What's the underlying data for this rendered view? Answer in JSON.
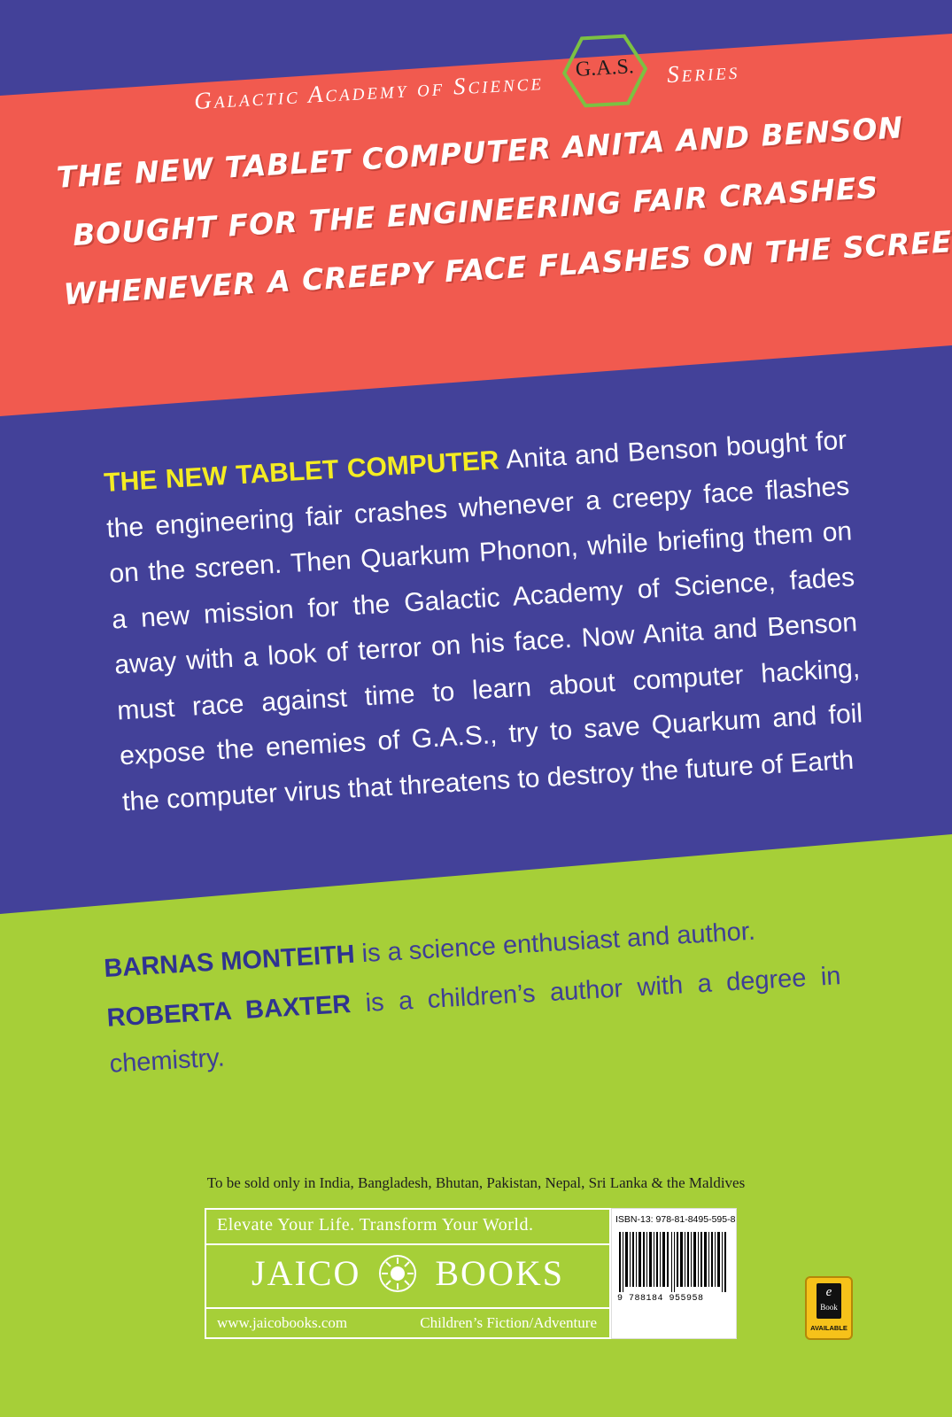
{
  "colors": {
    "indigo": "#434199",
    "salmon": "#f15a4f",
    "lime": "#a6cf38",
    "highlight_yellow": "#f4ec22",
    "author_blue": "#2f3391",
    "hexagon_green": "#7cc142"
  },
  "series": {
    "left_text": "Galactic Academy of Science",
    "badge_text": "G.A.S.",
    "right_text": "Series"
  },
  "tagline": {
    "line1": "The new tablet computer Anita and Benson",
    "line2": "bought for the engineering fair crashes",
    "line3": "whenever a creepy face flashes on the screen."
  },
  "blurb": {
    "lead": "THE NEW TABLET COMPUTER",
    "text": " Anita and Benson bought for the engineering fair crashes whenever a creepy face flashes on the screen. Then Quarkum Phonon, while briefing them on a new mission for the Galactic Academy of Science, fades away with a look of terror on his face. Now Anita and Benson must race against time to learn about computer hacking, expose the enemies of G.A.S., try to save Quarkum and foil the computer virus that threatens to destroy the future of Earth"
  },
  "authors": [
    {
      "name": "BARNAS MONTEITH",
      "bio": " is a science enthusiast and author."
    },
    {
      "name": "ROBERTA BAXTER",
      "bio": " is a children’s author with a degree in chemistry."
    }
  ],
  "sold_note": "To be sold only in India, Bangladesh, Bhutan, Pakistan, Nepal, Sri Lanka & the Maldives",
  "publisher": {
    "slogan": "Elevate Your Life. Transform Your World.",
    "brand_left": "JAICO",
    "brand_right": "BOOKS",
    "logo_icon": "sun-emblem-icon",
    "url": "www.jaicobooks.com",
    "genre": "Children’s Fiction/Adventure"
  },
  "isbn": {
    "label": "ISBN-13: 978-81-8495-595-8",
    "barcode_digits": "9 788184 955958"
  },
  "ebook": {
    "badge_letter": "e",
    "badge_word": "Book",
    "status": "AVAILABLE"
  }
}
